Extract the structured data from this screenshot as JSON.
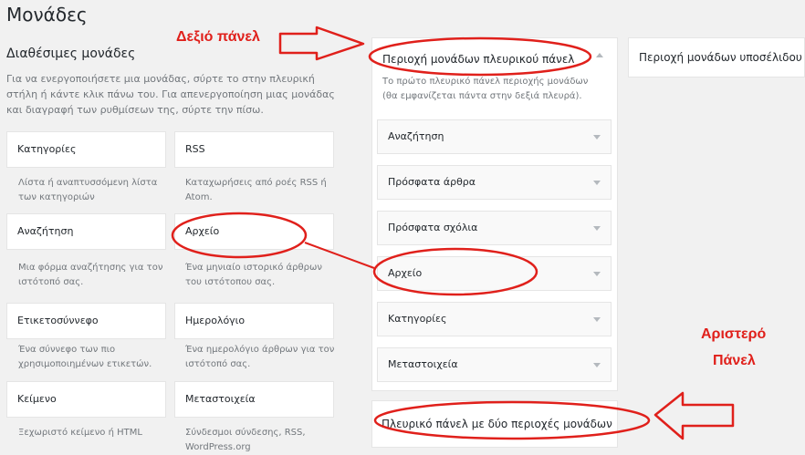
{
  "page_title": "Μονάδες",
  "available": {
    "title": "Διαθέσιμες μονάδες",
    "desc": "Για να ενεργοποιήσετε μια μονάδας, σύρτε το στην πλευρική στήλη ή κάντε κλικ πάνω του. Για απενεργοποίηση μιας μονάδας και διαγραφή των ρυθμίσεων της, σύρτε την πίσω."
  },
  "widgets": [
    {
      "title": "Κατηγορίες",
      "desc": "Λίστα ή αναπτυσσόμενη λίστα των κατηγοριών"
    },
    {
      "title": "RSS",
      "desc": "Καταχωρήσεις από ροές RSS ή Atom."
    },
    {
      "title": "Αναζήτηση",
      "desc": "Μια φόρμα αναζήτησης για τον ιστότοπό σας."
    },
    {
      "title": "Αρχείο",
      "desc": "Ένα μηνιαίο ιστορικό άρθρων του ιστότοπου σας."
    },
    {
      "title": "Ετικετοσύννεφο",
      "desc": "Ένα σύννεφο των πιο χρησιμοποιημένων ετικετών."
    },
    {
      "title": "Ημερολόγιο",
      "desc": "Ένα ημερολόγιο άρθρων για τον ιστότοπό σας."
    },
    {
      "title": "Κείμενο",
      "desc": "Ξεχωριστό κείμενο ή HTML"
    },
    {
      "title": "Μεταστοιχεία",
      "desc": "Σύνδεσμοι σύνδεσης, RSS, WordPress.org"
    }
  ],
  "sidebar": {
    "title": "Περιοχή μονάδων πλευρικού πάνελ",
    "desc": "Το πρώτο πλευρικό πάνελ περιοχής μονάδων (θα εμφανίζεται πάντα στην δεξιά πλευρά).",
    "items": [
      "Αναζήτηση",
      "Πρόσφατα άρθρα",
      "Πρόσφατα σχόλια",
      "Αρχείο",
      "Κατηγορίες",
      "Μεταστοιχεία"
    ]
  },
  "sidebar2": {
    "title": "Πλευρικό πάνελ με δύο περιοχές μονάδων"
  },
  "footer_area": {
    "title": "Περιοχή μονάδων υποσέλιδου"
  },
  "annotations": {
    "right_panel": "Δεξιό πάνελ",
    "left_panel_1": "Αριστερό",
    "left_panel_2": "Πάνελ"
  },
  "colors": {
    "annotation": "#e0201b",
    "background": "#f1f1f1"
  }
}
